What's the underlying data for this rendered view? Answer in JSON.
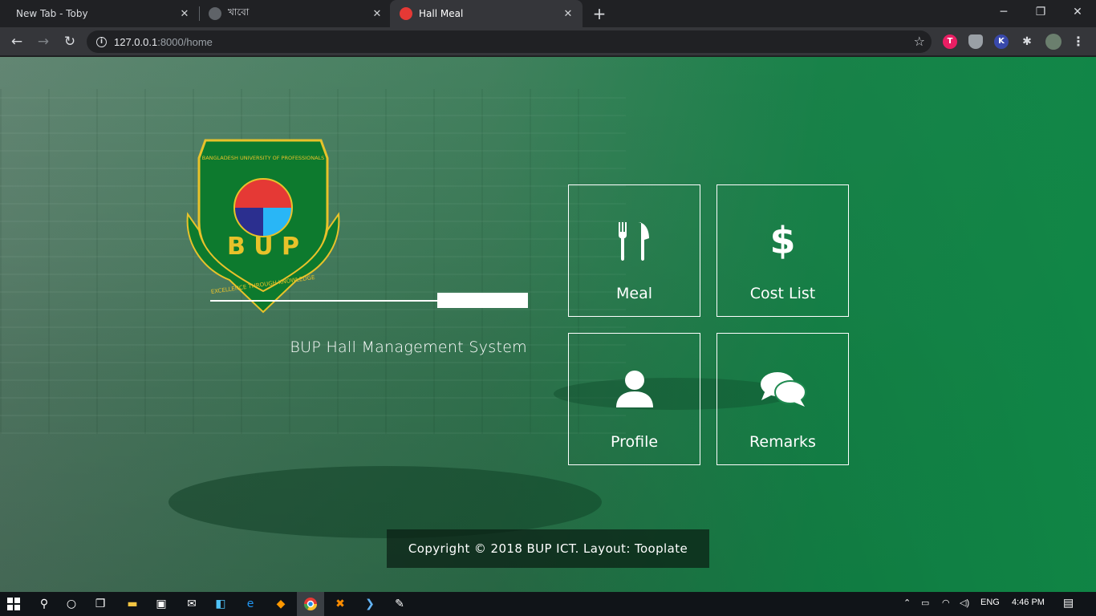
{
  "browser": {
    "tabs": [
      {
        "title": "New Tab - Toby",
        "active": false
      },
      {
        "title": "খাবো",
        "active": false
      },
      {
        "title": "Hall Meal",
        "active": true
      }
    ],
    "url_host": "127.0.0.1",
    "url_rest": ":8000/home",
    "window_controls": {
      "minimize": "─",
      "restore": "❐",
      "close": "✕"
    },
    "new_tab_label": "+"
  },
  "page": {
    "logo": {
      "top_text": "BANGLADESH UNIVERSITY OF PROFESSIONALS",
      "acronym": "B U P",
      "motto": "EXCELLENCE THROUGH KNOWLEDGE"
    },
    "system_title": "BUP Hall Management System",
    "tiles": [
      {
        "label": "Meal",
        "icon": "utensils-icon"
      },
      {
        "label": "Cost List",
        "icon": "dollar-icon"
      },
      {
        "label": "Profile",
        "icon": "user-icon"
      },
      {
        "label": "Remarks",
        "icon": "comments-icon"
      }
    ],
    "footer": "Copyright © 2018 BUP ICT. Layout: Tooplate"
  },
  "taskbar": {
    "language": "ENG",
    "time": "4:46 PM"
  },
  "colors": {
    "accent_green": "#128246",
    "logo_green": "#0d7a2e",
    "logo_gold": "#e8c22a"
  }
}
